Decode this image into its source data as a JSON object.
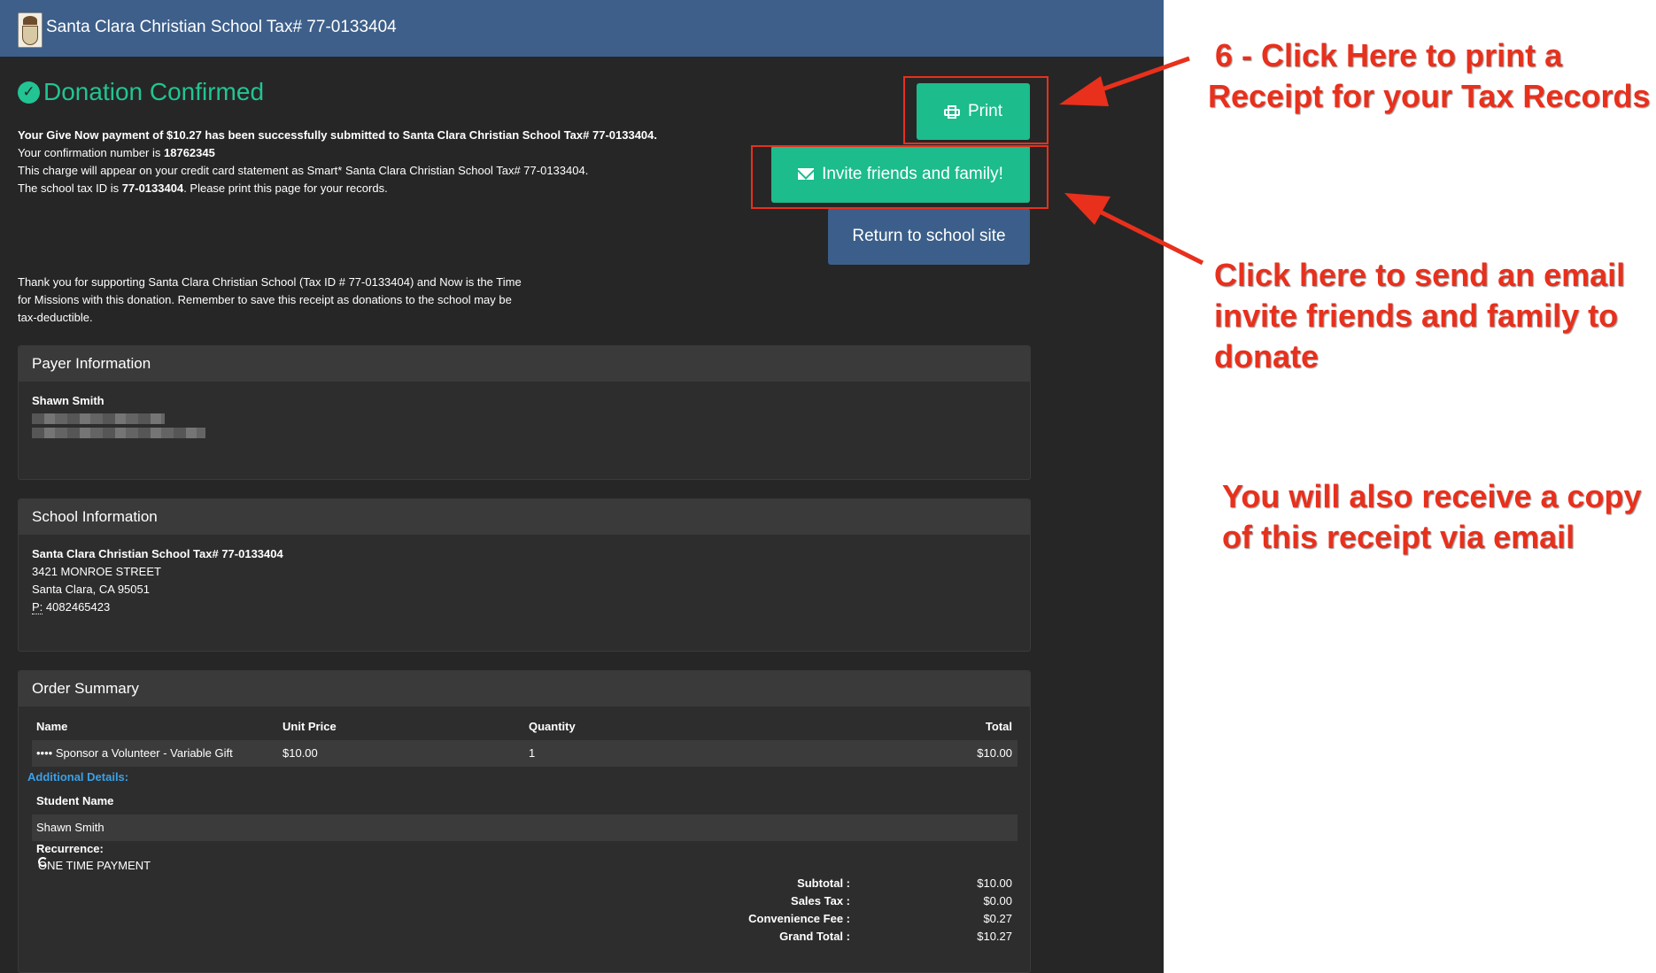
{
  "header": {
    "title": "Santa Clara Christian School Tax# 77-0133404"
  },
  "confirmation": {
    "heading": "Donation Confirmed",
    "line1_pre": "Your Give Now payment of $10.27 has been successfully submitted to Santa Clara Christian School Tax# 77-0133404.",
    "line2_pre": "Your confirmation number is ",
    "confirmation_number": "18762345",
    "line3": "This charge will appear on your credit card statement as Smart* Santa Clara Christian School Tax# 77-0133404.",
    "line4_pre": "The school tax ID is ",
    "tax_id": "77-0133404",
    "line4_post": ".  Please print this page for your records.",
    "thanks": "Thank you for supporting Santa Clara Christian School (Tax ID # 77-0133404) and Now is the Time for Missions with this donation. Remember to save this receipt as donations to the school may be tax-deductible."
  },
  "buttons": {
    "print": "Print",
    "invite": "Invite friends and family!",
    "return": "Return to school site"
  },
  "payer": {
    "heading": "Payer Information",
    "name": "Shawn Smith"
  },
  "school": {
    "heading": "School Information",
    "name": "Santa Clara Christian School Tax# 77-0133404",
    "street": "3421 MONROE STREET",
    "city": "Santa Clara, CA 95051",
    "phone_label": "P:",
    "phone": "4082465423"
  },
  "order": {
    "heading": "Order Summary",
    "columns": [
      "Name",
      "Unit Price",
      "Quantity",
      "Total"
    ],
    "rows": [
      {
        "name": "•••• Sponsor a Volunteer - Variable Gift",
        "price": "$10.00",
        "qty": "1",
        "total": "$10.00"
      }
    ],
    "additional_label": "Additional Details:",
    "student_label": "Student Name",
    "student_value": "Shawn Smith",
    "recurrence_label": "Recurrence:",
    "recurrence_value": "ONE TIME PAYMENT",
    "totals": [
      {
        "label": "Subtotal :",
        "value": "$10.00"
      },
      {
        "label": "Sales Tax :",
        "value": "$0.00"
      },
      {
        "label": "Convenience Fee :",
        "value": "$0.27"
      },
      {
        "label": "Grand Total :",
        "value": "$10.27"
      }
    ]
  },
  "annotations": {
    "print_note_line1": "6 - Click Here to print a",
    "print_note_line2": "Receipt for your Tax Records",
    "invite_note_line1": "Click here to send an email",
    "invite_note_line2": "invite friends and family to",
    "invite_note_line3": "donate",
    "copy_note_line1": "You will also receive a copy",
    "copy_note_line2": "of this receipt via email",
    "color": "#e8301c"
  },
  "colors": {
    "header_bg": "#3d5f8a",
    "page_bg": "#262626",
    "accent_green": "#1cbc8c",
    "link_blue": "#3aa0e6"
  }
}
